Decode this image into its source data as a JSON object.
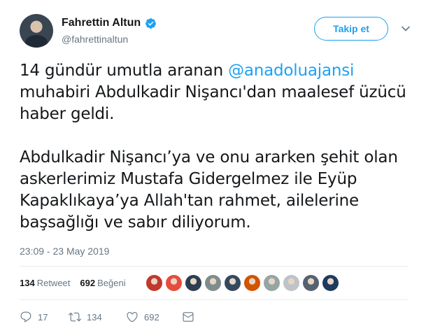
{
  "author": {
    "name": "Fahrettin Altun",
    "handle": "@fahrettinaltun",
    "verified": true
  },
  "follow_button": "Takip et",
  "tweet": {
    "line1_pre": "14 gündür umutla aranan ",
    "mention": "@anadoluajansi",
    "line1_post": " muhabiri Abdulkadir Nişancı'dan maalesef üzücü haber geldi.",
    "para2": "Abdulkadir Nişancı’ya ve onu ararken şehit olan askerlerimiz Mustafa Gidergelmez ile Eyüp Kapaklıkaya’ya Allah'tan rahmet, ailelerine başsağlığı ve sabır diliyorum."
  },
  "timestamp": "23:09 - 23 May 2019",
  "stats": {
    "retweet_count": "134",
    "retweet_label": "Retweet",
    "like_count": "692",
    "like_label": "Beğeni"
  },
  "actions": {
    "reply_count": "17",
    "retweet_count": "134",
    "like_count": "692"
  },
  "colors": {
    "accent": "#1da1f2",
    "secondary_text": "#657786",
    "text": "#14171a",
    "divider": "#e6ecf0"
  },
  "liker_avatars": [
    "#c0392b",
    "#e74c3c",
    "#2c3e50",
    "#7f8c8d",
    "#34495e",
    "#d35400",
    "#95a5a6",
    "#bdc3c7",
    "#556270",
    "#1f3a5f"
  ]
}
